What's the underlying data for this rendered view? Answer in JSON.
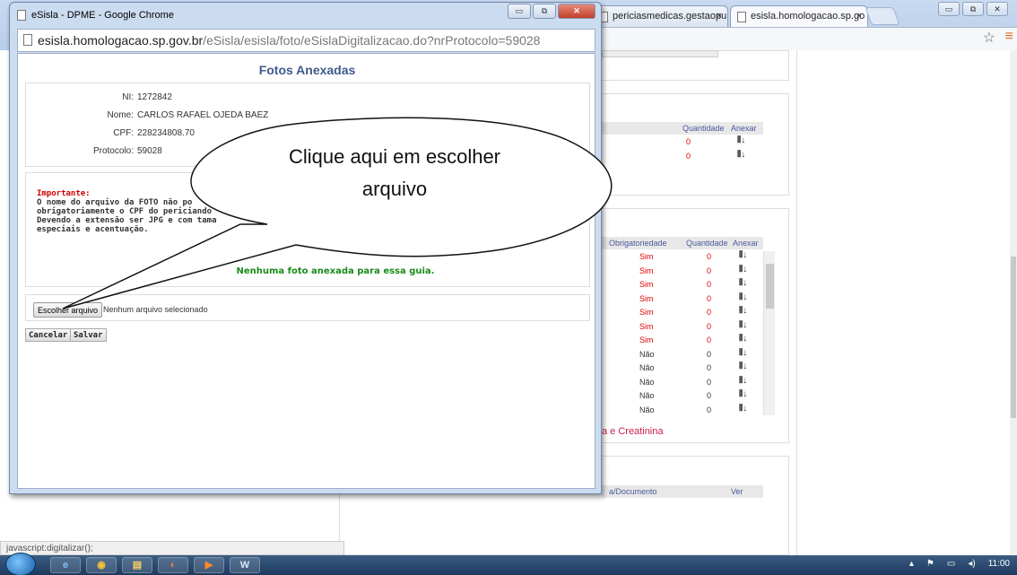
{
  "background_browser": {
    "tabs": [
      {
        "label": "periciasmedicas.gestaopu"
      },
      {
        "label": "esisla.homologacao.sp.go"
      }
    ],
    "tab_close": "×",
    "window_controls": [
      "▭",
      "⧉",
      "✕"
    ],
    "status_bar": "javascript:digitalizar();"
  },
  "background_page": {
    "table1": {
      "headers": [
        "Quantidade",
        "Anexar"
      ],
      "rows": [
        {
          "qty": "0"
        },
        {
          "qty": "0"
        }
      ]
    },
    "table2": {
      "headers": [
        "Obrigatoriedade",
        "Quantidade",
        "Anexar"
      ],
      "rows": [
        {
          "req": "Sim",
          "qty": "0"
        },
        {
          "req": "Sim",
          "qty": "0"
        },
        {
          "req": "Sim",
          "qty": "0"
        },
        {
          "req": "Sim",
          "qty": "0"
        },
        {
          "req": "Sim",
          "qty": "0"
        },
        {
          "req": "Sim",
          "qty": "0"
        },
        {
          "req": "Sim",
          "qty": "0"
        },
        {
          "req": "Não",
          "qty": "0"
        },
        {
          "req": "Não",
          "qty": "0"
        },
        {
          "req": "Não",
          "qty": "0"
        },
        {
          "req": "Não",
          "qty": "0"
        },
        {
          "req": "Não",
          "qty": "0"
        }
      ]
    },
    "link_text": "a e Creatinina",
    "table3": {
      "headers": [
        "a/Documento",
        "Ver"
      ]
    }
  },
  "popup": {
    "title": "eSisla - DPME - Google Chrome",
    "url_host": "esisla.homologacao.sp.gov.br",
    "url_path": "/eSisla/esisla/foto/eSislaDigitalizacao.do?nrProtocolo=59028",
    "page_title": "Fotos Anexadas",
    "info": {
      "ni_label": "NI:",
      "ni": "1272842",
      "nome_label": "Nome:",
      "nome": "CARLOS RAFAEL OJEDA BAEZ",
      "cpf_label": "CPF:",
      "cpf": "228234808.70",
      "protocolo_label": "Protocolo:",
      "protocolo": "59028"
    },
    "warning": {
      "title": "Importante:",
      "lines": [
        "O nome do arquivo da FOTO não po",
        "obrigatoriamente o CPF do periciando",
        "Devendo a extensão ser JPG e com tama",
        "especiais e acentuação."
      ]
    },
    "no_photo": "Nenhuma foto anexada para essa guia.",
    "choose_file": "Escolher arquivo",
    "no_file": "Nenhum arquivo selecionado",
    "cancel": "Cancelar",
    "save": "Salvar"
  },
  "callout": {
    "line1": "Clique aqui em escolher",
    "line2": "arquivo"
  },
  "taskbar": {
    "time": "11:00"
  }
}
